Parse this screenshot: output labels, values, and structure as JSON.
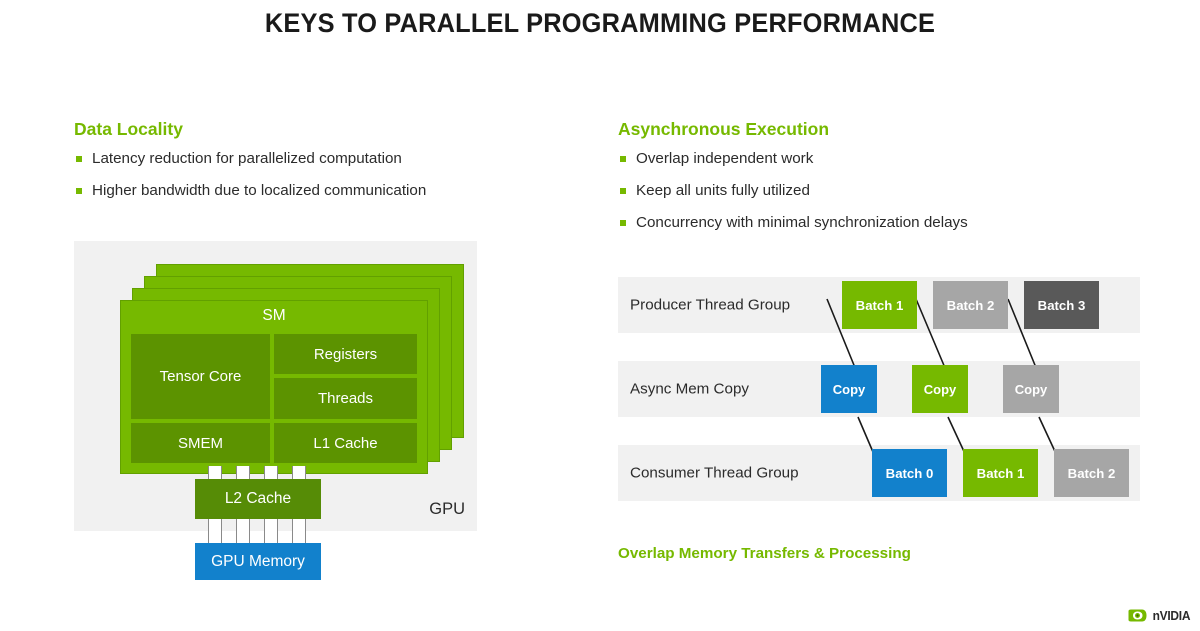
{
  "title": "KEYS TO PARALLEL PROGRAMMING PERFORMANCE",
  "colors": {
    "nvidia_green": "#76b900",
    "dark_green": "#5c9300",
    "l2_green": "#568c06",
    "blue": "#1281cc",
    "light_gray": "#a6a6a6",
    "dark_gray": "#595959",
    "panel_gray": "#f1f1f1",
    "text": "#2b2b2b"
  },
  "left_column": {
    "heading": "Data Locality",
    "bullets": [
      "Latency reduction for parallelized computation",
      "Higher bandwidth due to localized communication"
    ]
  },
  "right_column": {
    "heading": "Asynchronous Execution",
    "bullets": [
      "Overlap independent work",
      "Keep all units fully utilized",
      "Concurrency with minimal synchronization delays"
    ]
  },
  "gpu_diagram": {
    "panel_label": "GPU",
    "sm_title": "SM",
    "sm_cells": [
      {
        "label": "Tensor Core"
      },
      {
        "label": "Registers"
      },
      {
        "label": "Threads"
      },
      {
        "label": "SMEM"
      },
      {
        "label": "L1 Cache"
      }
    ],
    "l2_cache": "L2 Cache",
    "gpu_memory": "GPU Memory",
    "stack_count": 4
  },
  "async_diagram": {
    "rows": [
      {
        "label": "Producer Thread Group",
        "chips": [
          {
            "label": "Batch 1",
            "color": "#76b900"
          },
          {
            "label": "Batch 2",
            "color": "#a6a6a6"
          },
          {
            "label": "Batch 3",
            "color": "#595959"
          }
        ]
      },
      {
        "label": "Async Mem Copy",
        "chips": [
          {
            "label": "Copy",
            "color": "#1281cc"
          },
          {
            "label": "Copy",
            "color": "#76b900"
          },
          {
            "label": "Copy",
            "color": "#a6a6a6"
          }
        ]
      },
      {
        "label": "Consumer Thread Group",
        "chips": [
          {
            "label": "Batch 0",
            "color": "#1281cc"
          },
          {
            "label": "Batch 1",
            "color": "#76b900"
          },
          {
            "label": "Batch 2",
            "color": "#a6a6a6"
          }
        ]
      }
    ],
    "caption": "Overlap Memory Transfers & Processing"
  },
  "logo": {
    "wordmark": "nVIDIA",
    "icon": "nvidia-eye-icon"
  }
}
